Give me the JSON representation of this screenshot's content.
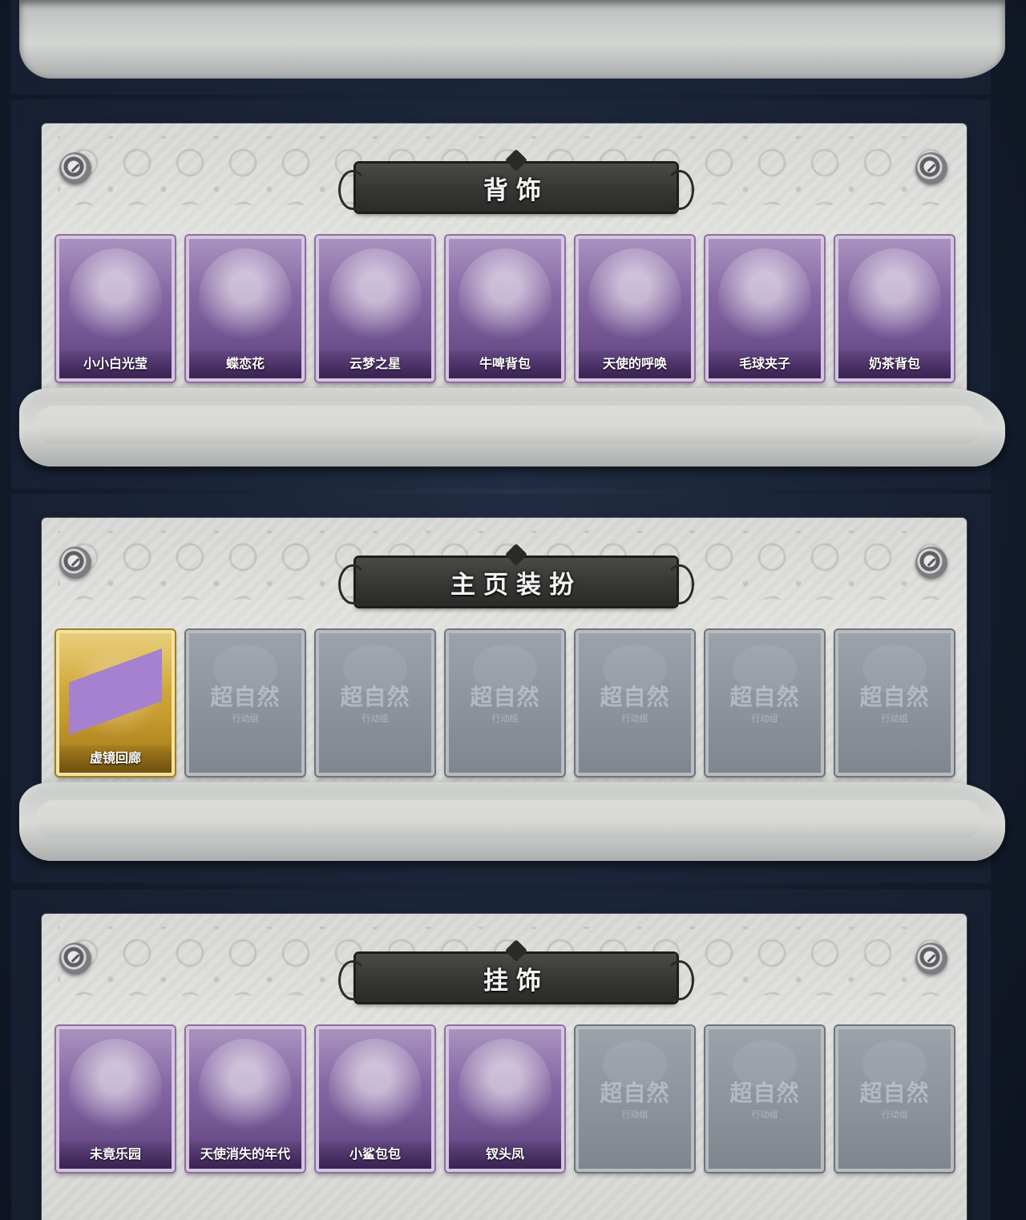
{
  "sections": [
    {
      "title": "背饰",
      "cards": [
        {
          "label": "小小白光莹",
          "style": "purple",
          "icon": "ornament-icon"
        },
        {
          "label": "蝶恋花",
          "style": "purple",
          "icon": "ornament-icon"
        },
        {
          "label": "云梦之星",
          "style": "purple",
          "icon": "ornament-icon"
        },
        {
          "label": "牛啤背包",
          "style": "purple",
          "icon": "ornament-icon"
        },
        {
          "label": "天使的呼唤",
          "style": "purple",
          "icon": "ornament-icon"
        },
        {
          "label": "毛球夹子",
          "style": "purple",
          "icon": "ornament-icon"
        },
        {
          "label": "奶茶背包",
          "style": "purple",
          "icon": "ornament-icon"
        }
      ]
    },
    {
      "title": "主页装扮",
      "cards": [
        {
          "label": "虚镜回廊",
          "style": "gold",
          "icon": "ornament-icon"
        },
        {
          "label": "",
          "style": "empty"
        },
        {
          "label": "",
          "style": "empty"
        },
        {
          "label": "",
          "style": "empty"
        },
        {
          "label": "",
          "style": "empty"
        },
        {
          "label": "",
          "style": "empty"
        },
        {
          "label": "",
          "style": "empty"
        }
      ]
    },
    {
      "title": "挂饰",
      "cards": [
        {
          "label": "未竟乐园",
          "style": "purple",
          "icon": "ornament-icon"
        },
        {
          "label": "天使消失的年代",
          "style": "purple",
          "icon": "ornament-icon"
        },
        {
          "label": "小鲨包包",
          "style": "purple",
          "icon": "ornament-icon"
        },
        {
          "label": "钗头凤",
          "style": "purple",
          "icon": "ornament-icon"
        },
        {
          "label": "",
          "style": "empty"
        },
        {
          "label": "",
          "style": "empty"
        },
        {
          "label": "",
          "style": "empty"
        }
      ]
    }
  ],
  "placeholder": {
    "logo_text": "超自然",
    "sub_text": "行动组"
  }
}
